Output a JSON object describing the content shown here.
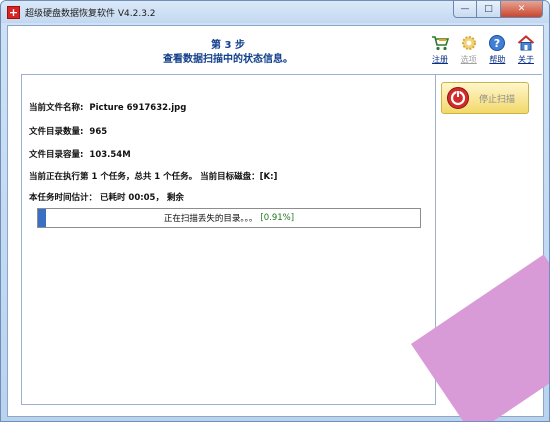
{
  "window": {
    "title": "超级硬盘数据恢复软件 V4.2.3.2",
    "app_icon_glyph": "+",
    "controls": {
      "minimize": "—",
      "maximize": "□",
      "close": "✕"
    }
  },
  "header": {
    "step": "第 3 步",
    "subtitle": "查看数据扫描中的状态信息。"
  },
  "toolbar": {
    "register": "注册",
    "options": "选项",
    "help": "帮助",
    "about": "关于"
  },
  "sidebar": {
    "stop_scan": "停止扫描"
  },
  "status": {
    "current_file_label": "当前文件名称:",
    "current_file_value": "Picture 6917632.jpg",
    "dir_count_label": "文件目录数量:",
    "dir_count_value": "965",
    "dir_size_label": "文件目录容量:",
    "dir_size_value": "103.54M",
    "task_info": "当前正在执行第 1 个任务，总共 1 个任务。 当前目标磁盘：[K:]",
    "time_estimate": "本任务时间估计： 已耗时 00:05， 剩余"
  },
  "progress": {
    "text": "正在扫描丢失的目录。。。",
    "percent_text": "[0.91%]",
    "fraction": 0.0091
  },
  "colors": {
    "accent": "#123f8a",
    "progress_fill": "#3a6fc4",
    "stop_button": "#f2d96a",
    "watermark": "#d99bd8"
  }
}
